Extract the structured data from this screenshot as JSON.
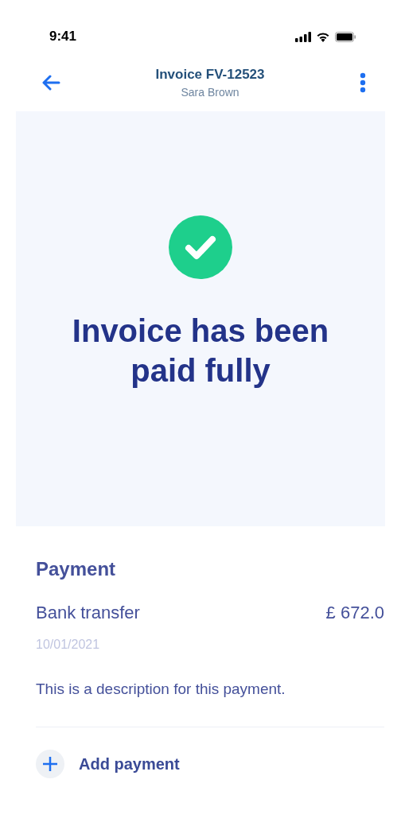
{
  "status_bar": {
    "time": "9:41"
  },
  "header": {
    "title": "Invoice FV-12523",
    "subtitle": "Sara Brown"
  },
  "banner": {
    "message": "Invoice has been paid fully"
  },
  "payment": {
    "heading": "Payment",
    "method": "Bank transfer",
    "amount": "£ 672.0",
    "date": "10/01/2021",
    "description": "This is a description for this payment."
  },
  "add_button": {
    "label": "Add payment"
  }
}
